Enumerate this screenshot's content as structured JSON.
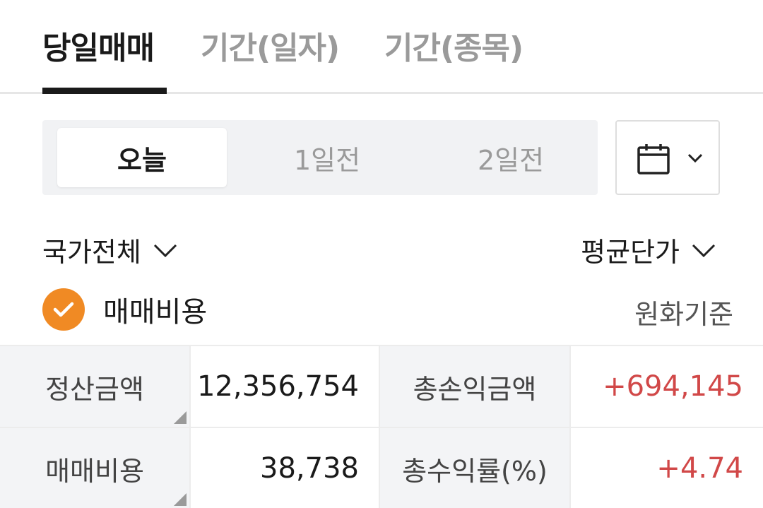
{
  "tabs": [
    {
      "label": "당일매매",
      "active": true
    },
    {
      "label": "기간(일자)",
      "active": false
    },
    {
      "label": "기간(종목)",
      "active": false
    }
  ],
  "day_selector": {
    "options": [
      "오늘",
      "1일전",
      "2일전"
    ],
    "selected": "오늘"
  },
  "calendar_button": {
    "icon": "calendar-icon",
    "dropdown_icon": "chevron-down-icon"
  },
  "filters": {
    "country": "국가전체",
    "price_basis": "평균단가"
  },
  "fee_toggle": {
    "label": "매매비용",
    "checked": true
  },
  "currency_basis": "원화기준",
  "summary": {
    "settlement_label": "정산금액",
    "settlement_value": "12,356,754",
    "total_pl_label": "총손익금액",
    "total_pl_value": "+694,145",
    "fee_label": "매매비용",
    "fee_value": "38,738",
    "return_rate_label": "총수익률(%)",
    "return_rate_value": "+4.74"
  },
  "colors": {
    "accent_orange": "#f08a24",
    "positive_red": "#d14848",
    "active_text": "#1a1a1a",
    "inactive_text": "#9a9a9a"
  }
}
